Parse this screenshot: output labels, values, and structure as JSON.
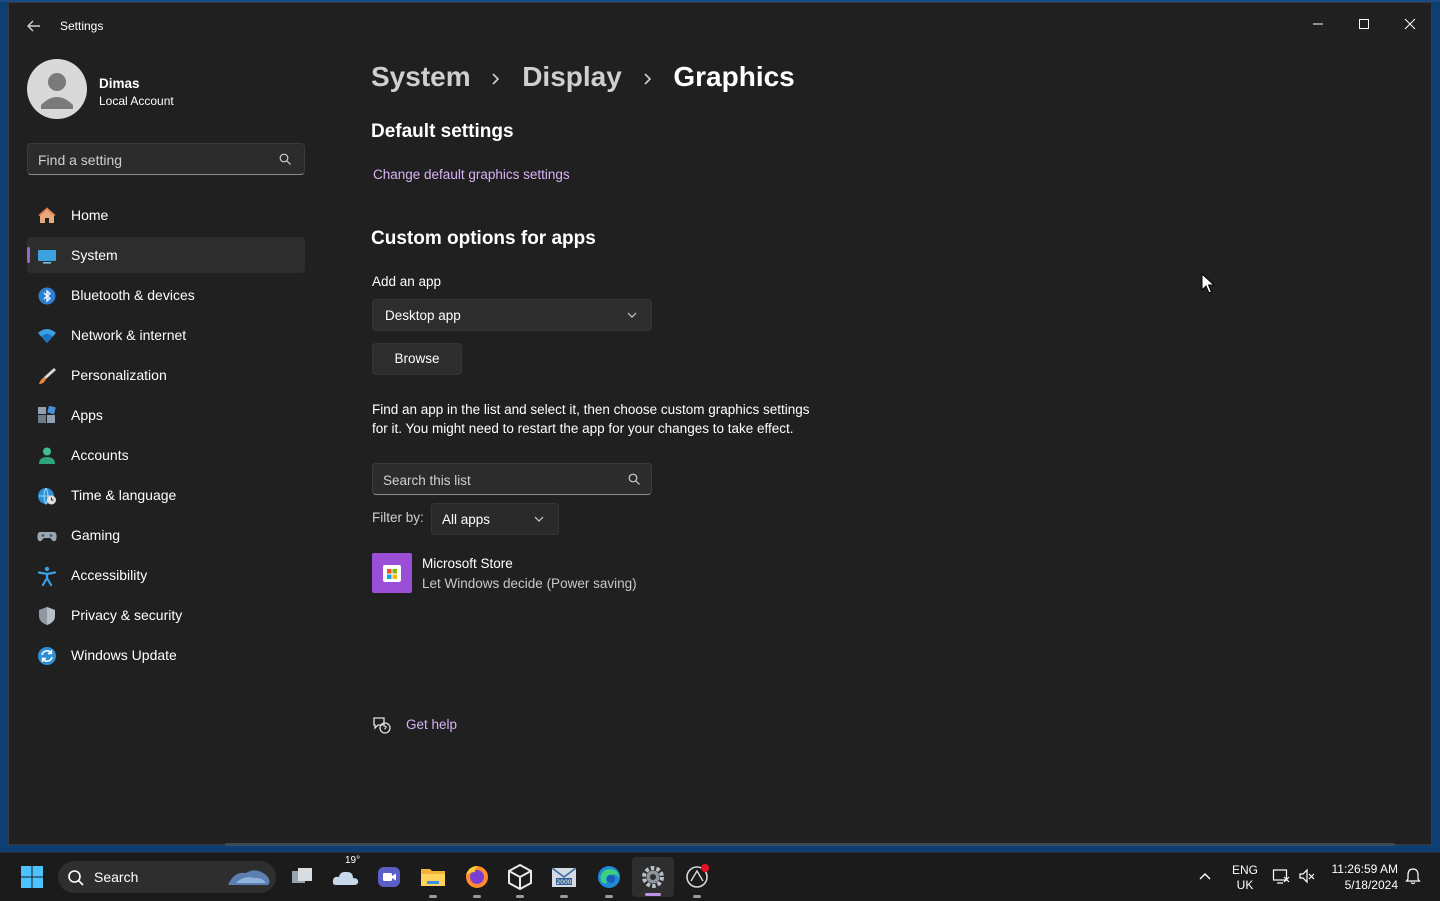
{
  "window": {
    "title": "Settings"
  },
  "profile": {
    "name": "Dimas",
    "account_type": "Local Account"
  },
  "sidebar": {
    "search_placeholder": "Find a setting",
    "items": [
      {
        "label": "Home",
        "icon": "home-icon"
      },
      {
        "label": "System",
        "icon": "system-icon",
        "selected": true
      },
      {
        "label": "Bluetooth & devices",
        "icon": "bluetooth-icon"
      },
      {
        "label": "Network & internet",
        "icon": "wifi-icon"
      },
      {
        "label": "Personalization",
        "icon": "brush-icon"
      },
      {
        "label": "Apps",
        "icon": "apps-icon"
      },
      {
        "label": "Accounts",
        "icon": "accounts-icon"
      },
      {
        "label": "Time & language",
        "icon": "globe-clock-icon"
      },
      {
        "label": "Gaming",
        "icon": "gamepad-icon"
      },
      {
        "label": "Accessibility",
        "icon": "accessibility-icon"
      },
      {
        "label": "Privacy & security",
        "icon": "shield-icon"
      },
      {
        "label": "Windows Update",
        "icon": "update-icon"
      }
    ]
  },
  "breadcrumb": [
    "System",
    "Display",
    "Graphics"
  ],
  "default_settings": {
    "title": "Default settings",
    "link": "Change default graphics settings"
  },
  "custom_options": {
    "title": "Custom options for apps",
    "add_app_label": "Add an app",
    "app_type_selected": "Desktop app",
    "browse_label": "Browse",
    "description": "Find an app in the list and select it, then choose custom graphics settings for it. You might need to restart the app for your changes to take effect.",
    "search_placeholder": "Search this list",
    "filter_label": "Filter by:",
    "filter_selected": "All apps",
    "apps": [
      {
        "name": "Microsoft Store",
        "setting": "Let Windows decide (Power saving)"
      }
    ]
  },
  "help": {
    "label": "Get help"
  },
  "taskbar": {
    "search_label": "Search",
    "weather_temp": "19°",
    "lang_primary": "ENG",
    "lang_secondary": "UK",
    "time": "11:26:59 AM",
    "date": "5/18/2024",
    "pinned_apps": [
      "task-view",
      "weather",
      "zoom",
      "file-explorer",
      "firefox",
      "unity",
      "mail",
      "edge",
      "settings",
      "app"
    ]
  },
  "colors": {
    "accent": "#9a63c8",
    "link": "#d7b3f5",
    "window_bg": "#202020",
    "taskbar_bg": "#1b1b1b"
  }
}
